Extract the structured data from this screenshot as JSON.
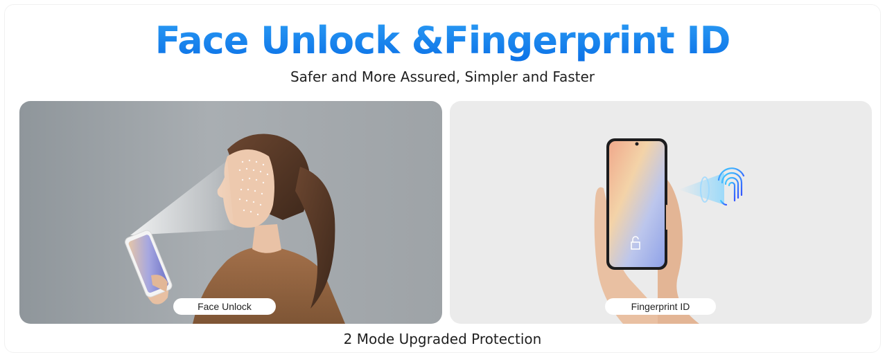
{
  "header": {
    "title": "Face Unlock &Fingerprint ID",
    "subtitle": "Safer and More Assured, Simpler and Faster"
  },
  "panels": [
    {
      "label": "Face Unlock",
      "image": "woman-face-scan-photo"
    },
    {
      "label": "Fingerprint ID",
      "image": "hand-holding-phone-fingerprint-photo"
    }
  ],
  "footer": {
    "caption": "2 Mode Upgraded Protection"
  },
  "colors": {
    "title_blue": "#1a86f0",
    "text": "#1f1f1f",
    "panel_right_bg": "#ebebeb"
  }
}
